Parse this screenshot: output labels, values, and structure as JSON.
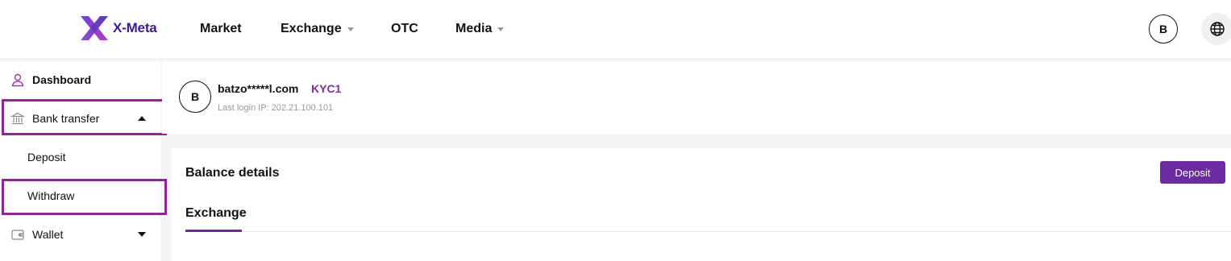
{
  "brand": {
    "name": "X-Meta",
    "color": "#3b1a8c",
    "accent": "#6a2ca0"
  },
  "nav": {
    "items": [
      {
        "label": "Market",
        "dropdown": false
      },
      {
        "label": "Exchange",
        "dropdown": true
      },
      {
        "label": "OTC",
        "dropdown": false
      },
      {
        "label": "Media",
        "dropdown": true
      }
    ],
    "avatar_letter": "B",
    "language_icon": "globe-icon"
  },
  "sidebar": {
    "items": [
      {
        "label": "Dashboard",
        "icon": "user-icon"
      },
      {
        "label": "Bank transfer",
        "icon": "bank-icon",
        "expanded": true,
        "highlighted": true
      },
      {
        "label": "Deposit"
      },
      {
        "label": "Withdraw",
        "highlighted": true
      },
      {
        "label": "Wallet",
        "icon": "wallet-icon",
        "expanded": false
      }
    ],
    "highlight_color": "#8e278f"
  },
  "profile": {
    "avatar_letter": "B",
    "email": "batzo*****l.com",
    "kyc": "KYC1",
    "last_login": "Last login IP: 202.21.100.101"
  },
  "balance": {
    "title": "Balance details",
    "deposit_label": "Deposit",
    "tabs": [
      {
        "label": "Exchange",
        "active": true
      }
    ]
  }
}
